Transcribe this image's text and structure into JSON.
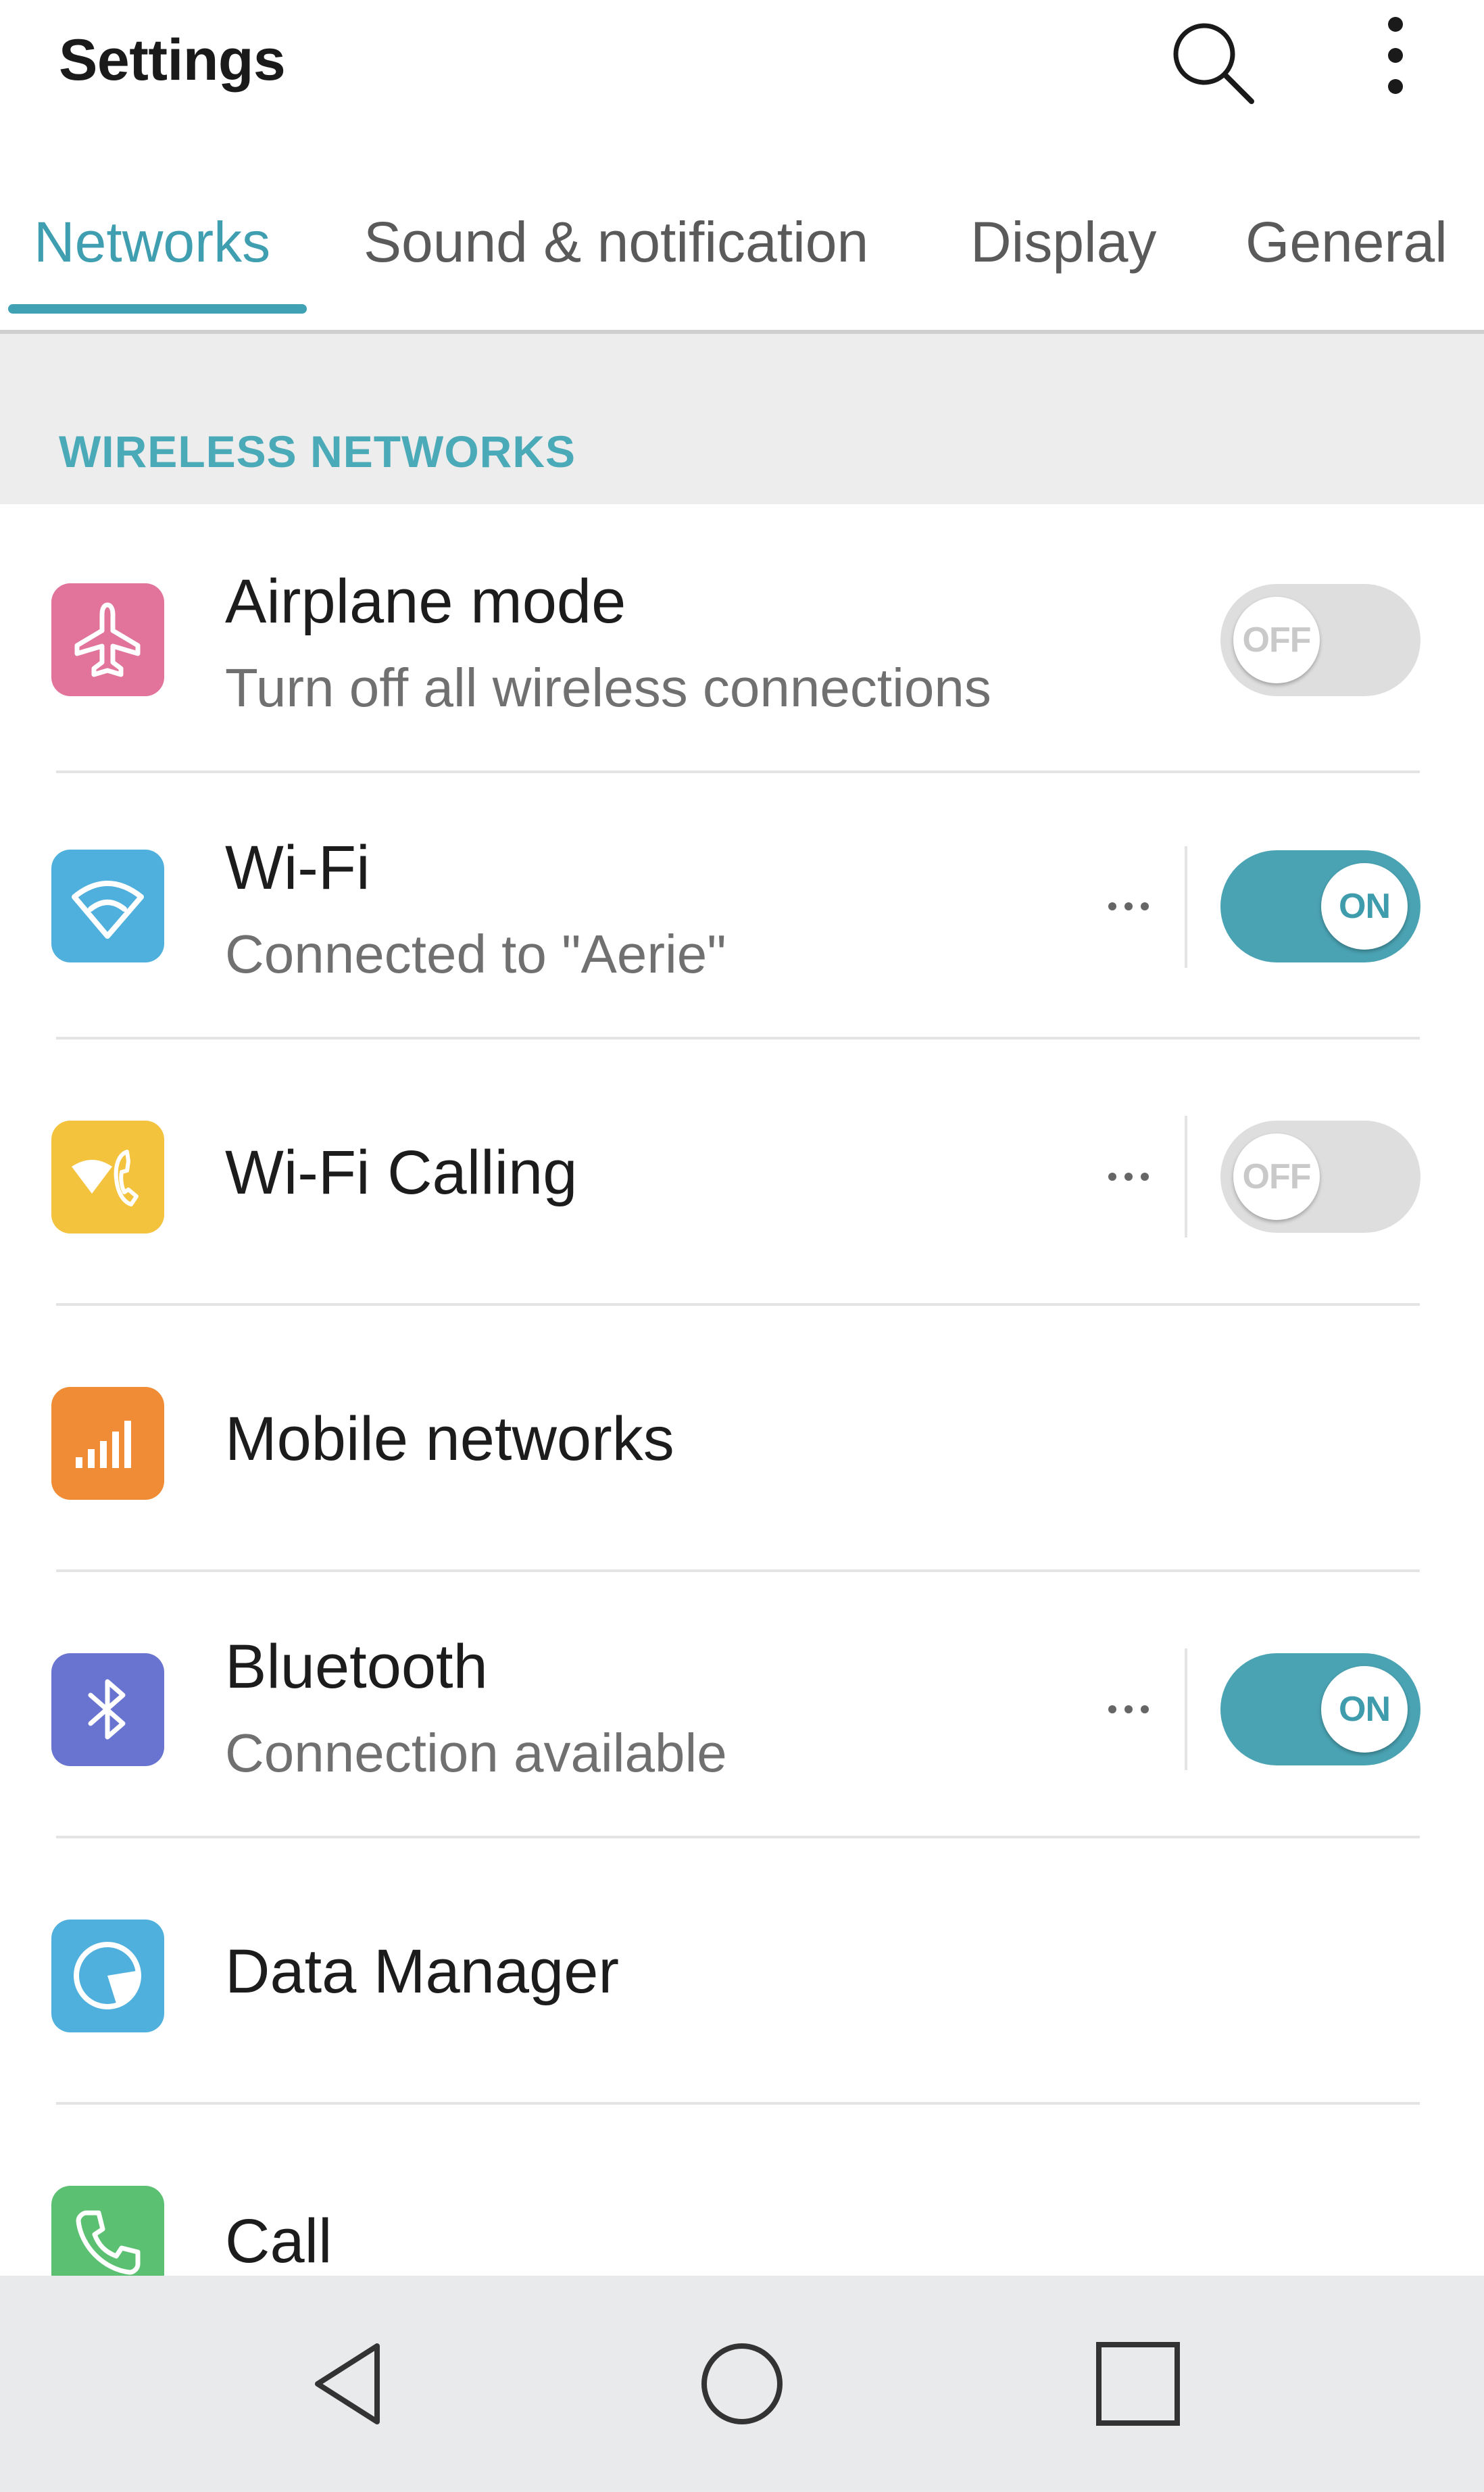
{
  "appbar": {
    "title": "Settings",
    "search_icon": "search-icon",
    "overflow_icon": "more-vert-icon"
  },
  "tabs": [
    {
      "label": "Networks",
      "active": true
    },
    {
      "label": "Sound & notification",
      "active": false
    },
    {
      "label": "Display",
      "active": false
    },
    {
      "label": "General",
      "active": false
    }
  ],
  "section": {
    "title": "WIRELESS NETWORKS"
  },
  "items": [
    {
      "title": "Airplane mode",
      "subtitle": "Turn off all wireless connections",
      "icon": "airplane-icon",
      "icon_color": "#e2739a",
      "toggle": "OFF"
    },
    {
      "title": "Wi-Fi",
      "subtitle": "Connected to \"Aerie\"",
      "icon": "wifi-icon",
      "icon_color": "#4fb0dd",
      "toggle": "ON"
    },
    {
      "title": "Wi-Fi Calling",
      "icon": "wifi-calling-icon",
      "icon_color": "#f4c33d",
      "toggle": "OFF"
    },
    {
      "title": "Mobile networks",
      "icon": "signal-bars-icon",
      "icon_color": "#ef8c35"
    },
    {
      "title": "Bluetooth",
      "subtitle": "Connection available",
      "icon": "bluetooth-icon",
      "icon_color": "#6874d0",
      "toggle": "ON"
    },
    {
      "title": "Data Manager",
      "icon": "data-manager-icon",
      "icon_color": "#4fb0dd"
    },
    {
      "title": "Call",
      "icon": "phone-icon",
      "icon_color": "#5cc072"
    }
  ],
  "colors": {
    "accent": "#4aa3b3",
    "toggle_off": "#dedede"
  },
  "navbar": {
    "back_icon": "back-triangle-icon",
    "home_icon": "home-circle-icon",
    "recents_icon": "recents-square-icon"
  }
}
